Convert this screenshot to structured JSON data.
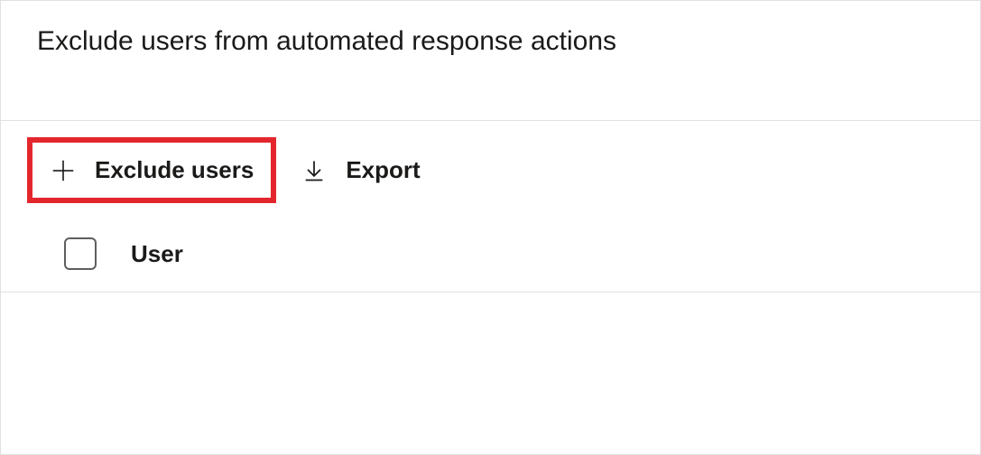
{
  "page": {
    "title": "Exclude users from automated response actions"
  },
  "toolbar": {
    "exclude_label": "Exclude users",
    "export_label": "Export"
  },
  "table": {
    "columns": {
      "user": "User"
    }
  }
}
